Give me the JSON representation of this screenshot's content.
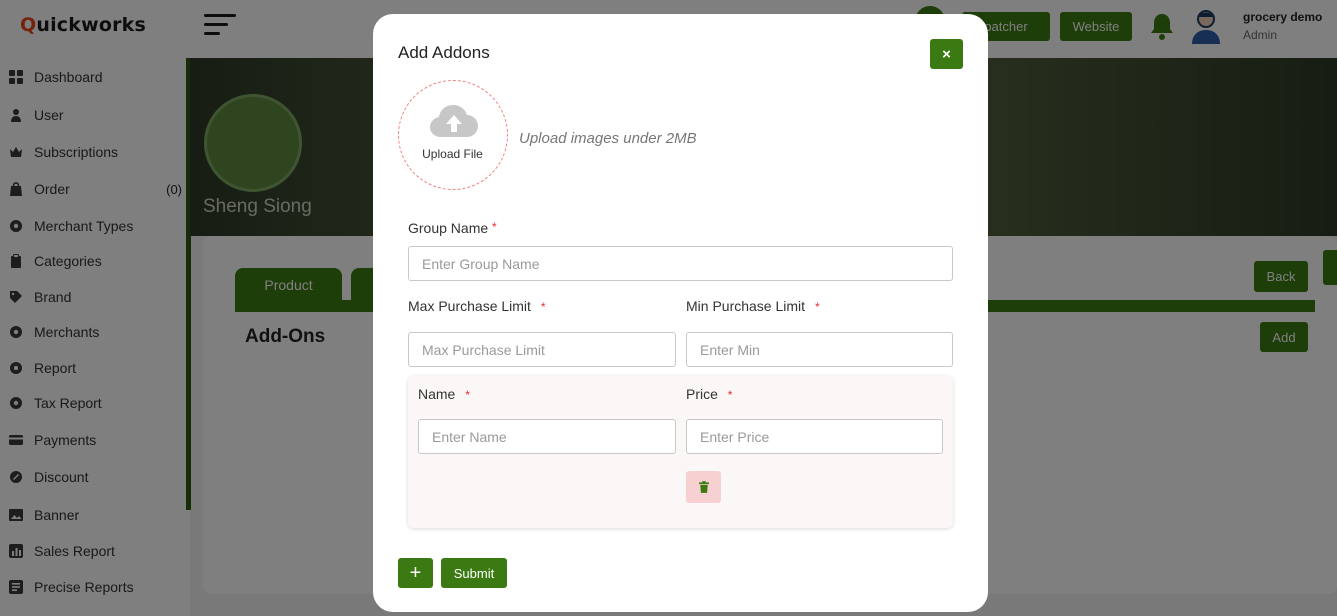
{
  "app": {
    "logo_first_letter": "Q",
    "logo_rest": "uickworks",
    "brand_color": "#3b7a12",
    "logo_accent_color": "#e8441c"
  },
  "sidebar": {
    "items": [
      {
        "label": "Dashboard",
        "icon": "grid-icon"
      },
      {
        "label": "User",
        "icon": "user-icon"
      },
      {
        "label": "Subscriptions",
        "icon": "crown-icon"
      },
      {
        "label": "Order",
        "icon": "bag-icon",
        "count": "(0)"
      },
      {
        "label": "Merchant Types",
        "icon": "settings-icon"
      },
      {
        "label": "Categories",
        "icon": "clipboard-icon"
      },
      {
        "label": "Brand",
        "icon": "tag-icon"
      },
      {
        "label": "Merchants",
        "icon": "settings-icon"
      },
      {
        "label": "Report",
        "icon": "settings-icon"
      },
      {
        "label": "Tax Report",
        "icon": "settings-icon"
      },
      {
        "label": "Payments",
        "icon": "card-icon"
      },
      {
        "label": "Discount",
        "icon": "discount-icon"
      },
      {
        "label": "Banner",
        "icon": "image-icon"
      },
      {
        "label": "Sales Report",
        "icon": "chart-icon"
      },
      {
        "label": "Precise Reports",
        "icon": "report-icon"
      }
    ]
  },
  "topbar": {
    "dispatcher_label": "patcher",
    "website_label": "Website",
    "user_name": "grocery demo",
    "user_role": "Admin"
  },
  "main": {
    "store_name": "Sheng Siong",
    "tab_product": "Product",
    "section_title": "Add-Ons",
    "back_label": "Back",
    "add_label": "Add"
  },
  "modal": {
    "title": "Add Addons",
    "close_label": "×",
    "upload_label": "Upload File",
    "upload_hint": "Upload images under 2MB",
    "required_mark": "*",
    "group_name_label": "Group Name",
    "group_name_placeholder": "Enter Group Name",
    "max_label": "Max Purchase Limit",
    "max_placeholder": "Max Purchase Limit",
    "min_label": "Min Purchase Limit",
    "min_placeholder": "Enter Min",
    "item_name_label": "Name",
    "item_name_placeholder": "Enter Name",
    "item_price_label": "Price",
    "item_price_placeholder": "Enter Price",
    "plus_label": "+",
    "submit_label": "Submit"
  }
}
